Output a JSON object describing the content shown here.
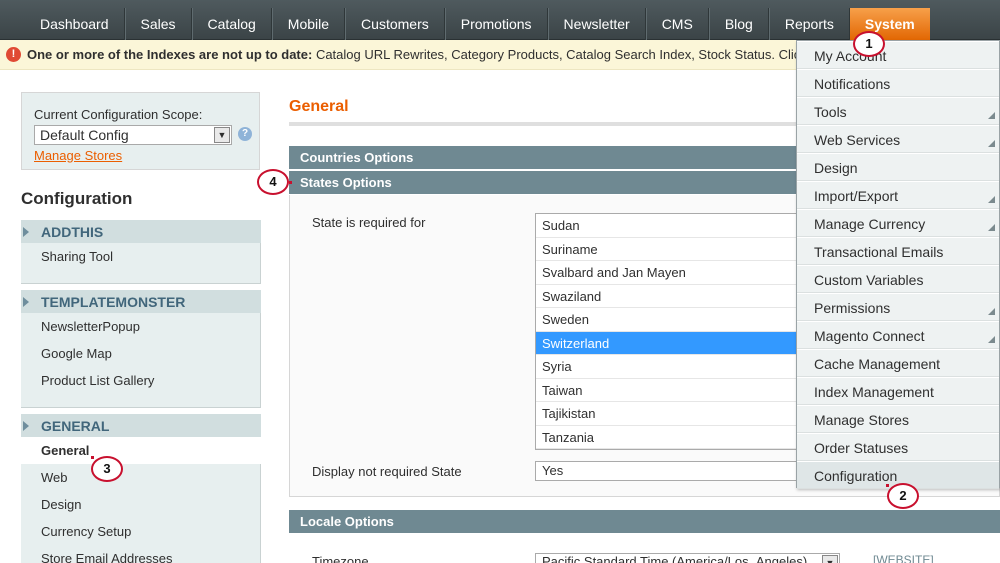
{
  "topnav": {
    "items": [
      "Dashboard",
      "Sales",
      "Catalog",
      "Mobile",
      "Customers",
      "Promotions",
      "Newsletter",
      "CMS",
      "Blog",
      "Reports",
      "System"
    ],
    "active": "System"
  },
  "message": {
    "icon": "error-icon",
    "bold": "One or more of the Indexes are not up to date:",
    "text": " Catalog URL Rewrites, Category Products, Catalog Search Index, Stock Status. Click here"
  },
  "scope": {
    "label": "Current Configuration Scope:",
    "value": "Default Config",
    "manage_link": "Manage Stores"
  },
  "config_title": "Configuration",
  "sidebar": {
    "addthis": {
      "head": "ADDTHIS",
      "items": [
        "Sharing Tool"
      ]
    },
    "templatemonster": {
      "head": "TEMPLATEMONSTER",
      "items": [
        "NewsletterPopup",
        "Google Map",
        "Product List Gallery"
      ]
    },
    "general": {
      "head": "GENERAL",
      "items": [
        "General",
        "Web",
        "Design",
        "Currency Setup",
        "Store Email Addresses"
      ]
    }
  },
  "main": {
    "title": "General",
    "countries_options": "Countries Options",
    "states_options": "States Options",
    "state_required_label": "State is required for",
    "state_options": [
      "Sudan",
      "Suriname",
      "Svalbard and Jan Mayen",
      "Swaziland",
      "Sweden",
      "Switzerland",
      "Syria",
      "Taiwan",
      "Tajikistan",
      "Tanzania"
    ],
    "state_selected": "Switzerland",
    "display_not_required_label": "Display not required State",
    "display_not_required_value": "Yes",
    "locale_options": "Locale Options",
    "timezone_label": "Timezone",
    "timezone_value": "Pacific Standard Time (America/Los_Angeles)",
    "timezone_scope": "[WEBSITE]"
  },
  "dropdown": {
    "items": [
      {
        "label": "My Account",
        "sub": false
      },
      {
        "label": "Notifications",
        "sub": false
      },
      {
        "label": "Tools",
        "sub": true
      },
      {
        "label": "Web Services",
        "sub": true
      },
      {
        "label": "Design",
        "sub": false
      },
      {
        "label": "Import/Export",
        "sub": true
      },
      {
        "label": "Manage Currency",
        "sub": true
      },
      {
        "label": "Transactional Emails",
        "sub": false
      },
      {
        "label": "Custom Variables",
        "sub": false
      },
      {
        "label": "Permissions",
        "sub": true
      },
      {
        "label": "Magento Connect",
        "sub": true
      },
      {
        "label": "Cache Management",
        "sub": false
      },
      {
        "label": "Index Management",
        "sub": false
      },
      {
        "label": "Manage Stores",
        "sub": false
      },
      {
        "label": "Order Statuses",
        "sub": false
      },
      {
        "label": "Configuration",
        "sub": false
      }
    ]
  },
  "callouts": [
    "1",
    "2",
    "3",
    "4"
  ],
  "colors": {
    "accent": "#eb5e00",
    "section_bar": "#6f8992",
    "selected": "#3399ff",
    "callout": "#c8102e"
  }
}
